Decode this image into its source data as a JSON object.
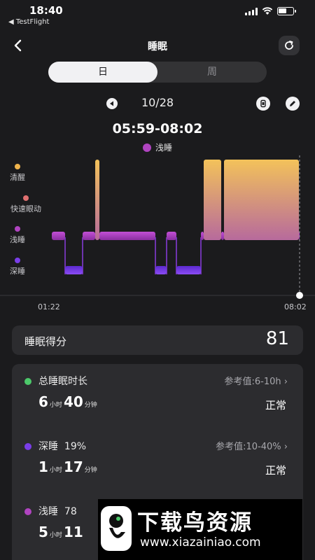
{
  "status_bar": {
    "time": "18:40",
    "back_app": "◀ TestFlight"
  },
  "nav": {
    "title": "睡眠"
  },
  "segment": {
    "day": "日",
    "week": "周"
  },
  "date": {
    "label": "10/28"
  },
  "sleep": {
    "time_range": "05:59-08:02",
    "legend": "浅睡",
    "stages": {
      "awake": "清醒",
      "rem": "快速眼动",
      "light": "浅睡",
      "deep": "深睡"
    },
    "axis_start": "01:22",
    "axis_end": "08:02"
  },
  "colors": {
    "awake": "#f0b44c",
    "rem": "#e07070",
    "light": "#b044c0",
    "deep": "#7a3ee8",
    "total": "#4cc96a"
  },
  "chart_data": {
    "type": "area",
    "x": [
      "01:22",
      "08:02"
    ],
    "stage_sequence": [
      "light",
      "deep",
      "light",
      "awake",
      "light",
      "deep",
      "light",
      "deep",
      "light",
      "awake",
      "light",
      "awake",
      "light"
    ],
    "legend": [
      "浅睡"
    ]
  },
  "score": {
    "title": "睡眠得分",
    "value": "81"
  },
  "metrics": [
    {
      "name": "总睡眠时长",
      "ref": "参考值:6-10h",
      "hours": "6",
      "h_unit": "小时",
      "minutes": "40",
      "m_unit": "分钟",
      "status": "正常"
    },
    {
      "name": "深睡",
      "percent": "19%",
      "ref": "参考值:10-40%",
      "hours": "1",
      "h_unit": "小时",
      "minutes": "17",
      "m_unit": "分钟",
      "status": "正常"
    },
    {
      "name": "浅睡",
      "percent": "78",
      "hours": "5",
      "h_unit": "小时",
      "minutes": "11"
    }
  ],
  "watermark": {
    "title": "下载鸟资源",
    "url": "www.xiazainiao.com"
  }
}
